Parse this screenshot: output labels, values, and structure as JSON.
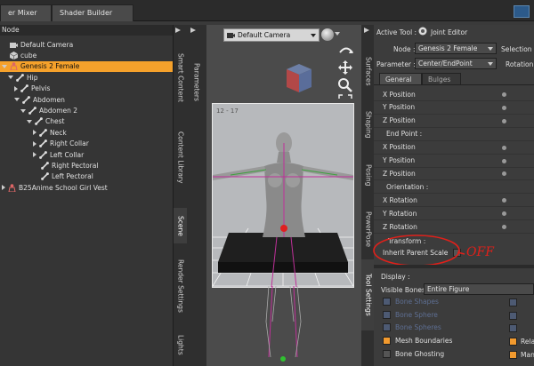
{
  "top_tabs": [
    "er Mixer",
    "Shader Builder"
  ],
  "scene": {
    "header": "Node",
    "items": [
      {
        "label": "Default Camera",
        "icon": "camera-icon",
        "level": 0,
        "arrow": "",
        "selected": false
      },
      {
        "label": "cube",
        "icon": "cube-icon",
        "level": 0,
        "arrow": "",
        "selected": false
      },
      {
        "label": "Genesis 2 Female",
        "icon": "figure-icon",
        "level": 0,
        "arrow": "down",
        "selected": true
      },
      {
        "label": "Hip",
        "icon": "bone-icon",
        "level": 1,
        "arrow": "down",
        "selected": false
      },
      {
        "label": "Pelvis",
        "icon": "bone-icon",
        "level": 2,
        "arrow": "right",
        "selected": false
      },
      {
        "label": "Abdomen",
        "icon": "bone-icon",
        "level": 2,
        "arrow": "down",
        "selected": false
      },
      {
        "label": "Abdomen 2",
        "icon": "bone-icon",
        "level": 3,
        "arrow": "down",
        "selected": false
      },
      {
        "label": "Chest",
        "icon": "bone-icon",
        "level": 4,
        "arrow": "down",
        "selected": false
      },
      {
        "label": "Neck",
        "icon": "bone-icon",
        "level": 5,
        "arrow": "right",
        "selected": false
      },
      {
        "label": "Right Collar",
        "icon": "bone-icon",
        "level": 5,
        "arrow": "right",
        "selected": false
      },
      {
        "label": "Left Collar",
        "icon": "bone-icon",
        "level": 5,
        "arrow": "right",
        "selected": false
      },
      {
        "label": "Right Pectoral",
        "icon": "bone-icon",
        "level": 5,
        "arrow": "",
        "selected": false
      },
      {
        "label": "Left Pectoral",
        "icon": "bone-icon",
        "level": 5,
        "arrow": "",
        "selected": false
      },
      {
        "label": "B25Anime School Girl Vest",
        "icon": "figure-icon",
        "level": 0,
        "arrow": "right",
        "selected": false
      }
    ]
  },
  "left_vtabs": [
    "Smart Content",
    "Content Library",
    "Scene",
    "Render Settings",
    "Lights"
  ],
  "param_tab": "Parameters",
  "viewport": {
    "camera": "Default Camera",
    "overlay_text": "12 - 17"
  },
  "right_vtabs": [
    "Surfaces",
    "Shaping",
    "Posing",
    "PowerPose",
    "Tool Settings"
  ],
  "tool": {
    "active_tool_label": "Active Tool :",
    "active_tool": "Joint Editor",
    "node_label": "Node :",
    "node_value": "Genesis 2 Female",
    "selection_label": "Selection G",
    "param_label": "Parameter :",
    "param_value": "Center/EndPoint",
    "rotation_label": "Rotation C",
    "tabs": [
      "General",
      "Bulges"
    ],
    "rows": [
      {
        "type": "value",
        "label": "X Position"
      },
      {
        "type": "value",
        "label": "Y Position"
      },
      {
        "type": "value",
        "label": "Z Position"
      },
      {
        "type": "header",
        "label": "End Point :"
      },
      {
        "type": "value",
        "label": "X Position"
      },
      {
        "type": "value",
        "label": "Y Position"
      },
      {
        "type": "value",
        "label": "Z Position"
      },
      {
        "type": "header",
        "label": "Orientation :"
      },
      {
        "type": "value",
        "label": "X Rotation"
      },
      {
        "type": "value",
        "label": "Y Rotation"
      },
      {
        "type": "value",
        "label": "Z Rotation"
      }
    ],
    "transform_label": "Transform :",
    "inherit_label": "Inherit Parent Scale",
    "annotation": "OFF",
    "display_label": "Display :",
    "visible_bones_label": "Visible Bones :",
    "visible_bones_value": "Entire Figure",
    "checks": [
      {
        "label": "Bone Shapes",
        "state": "dim"
      },
      {
        "label": "Bone Sphere",
        "state": "dim"
      },
      {
        "label": "Bone Spheres",
        "state": "dim"
      },
      {
        "label": "Mesh Boundaries",
        "state": "on"
      },
      {
        "label": "Bone Ghosting",
        "state": "off"
      }
    ],
    "right_checks": [
      "",
      "",
      "",
      "Rela",
      "Mani"
    ],
    "colors": {
      "selected": "#f5a12b",
      "annotation": "#e0201a"
    }
  }
}
